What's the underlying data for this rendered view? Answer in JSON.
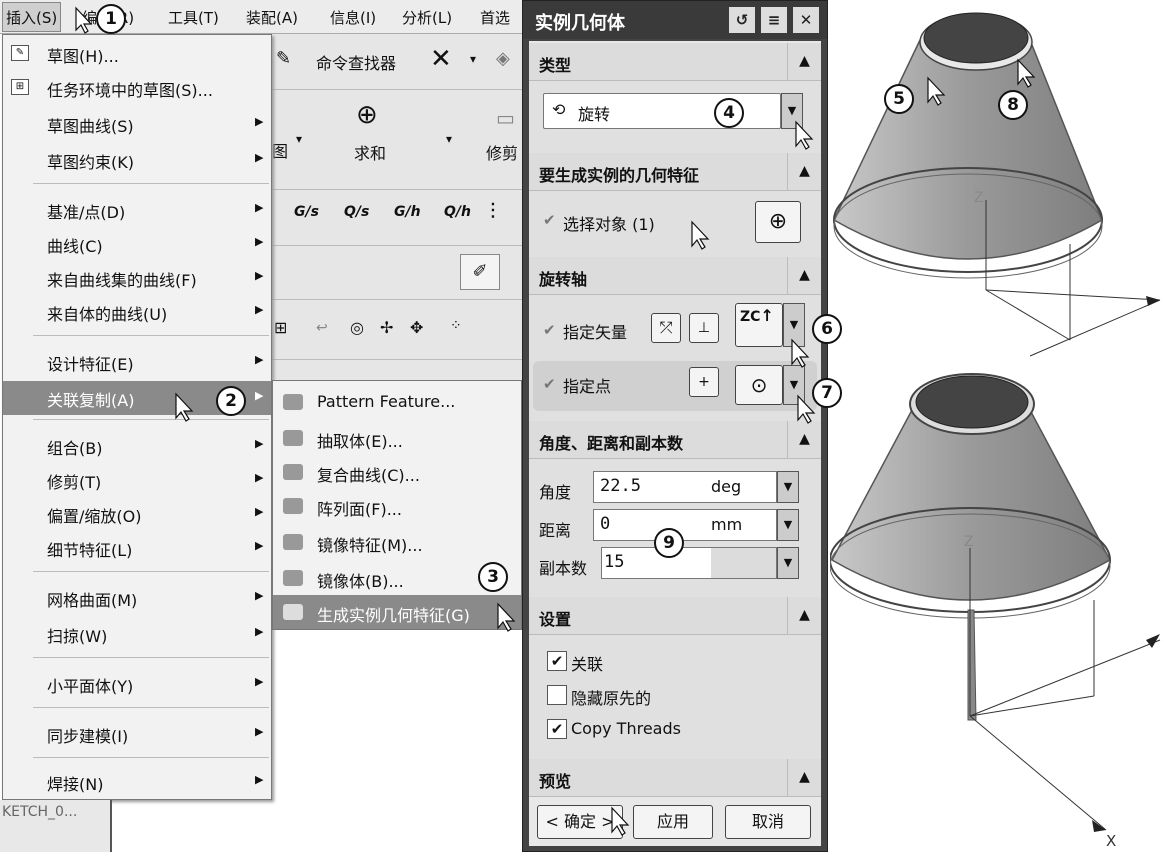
{
  "menubar": {
    "items": [
      "插入(S)",
      "编辑(R)",
      "工具(T)",
      "装配(A)",
      "信息(I)",
      "分析(L)",
      "首选"
    ]
  },
  "toolbar": {
    "command_finder": "命令查找器",
    "sum_label": "求和",
    "trim_label": "修剪",
    "tool_prefix": "图",
    "glyphs": [
      "G/s",
      "Q/s",
      "G/h",
      "Q/h"
    ]
  },
  "menu": {
    "items": [
      {
        "label": "草图(H)...",
        "icon": "sketch-icon",
        "arrow": false
      },
      {
        "label": "任务环境中的草图(S)...",
        "icon": "sketch-task-icon",
        "arrow": false
      },
      {
        "label": "草图曲线(S)",
        "arrow": true
      },
      {
        "label": "草图约束(K)",
        "arrow": true
      },
      {
        "label": "基准/点(D)",
        "arrow": true
      },
      {
        "label": "曲线(C)",
        "arrow": true
      },
      {
        "label": "来自曲线集的曲线(F)",
        "arrow": true
      },
      {
        "label": "来自体的曲线(U)",
        "arrow": true
      },
      {
        "label": "设计特征(E)",
        "arrow": true
      },
      {
        "label": "关联复制(A)",
        "arrow": true,
        "highlight": true
      },
      {
        "label": "组合(B)",
        "arrow": true
      },
      {
        "label": "修剪(T)",
        "arrow": true
      },
      {
        "label": "偏置/缩放(O)",
        "arrow": true
      },
      {
        "label": "细节特征(L)",
        "arrow": true
      },
      {
        "label": "网格曲面(M)",
        "arrow": true
      },
      {
        "label": "扫掠(W)",
        "arrow": true
      },
      {
        "label": "小平面体(Y)",
        "arrow": true
      },
      {
        "label": "同步建模(I)",
        "arrow": true
      },
      {
        "label": "焊接(N)",
        "arrow": true
      }
    ],
    "footer": "KETCH_0..."
  },
  "submenu": {
    "items": [
      {
        "label": "Pattern Feature...",
        "icon": "pattern-feature-icon"
      },
      {
        "label": "抽取体(E)...",
        "icon": "extract-body-icon"
      },
      {
        "label": "复合曲线(C)...",
        "icon": "composite-curve-icon"
      },
      {
        "label": "阵列面(F)...",
        "icon": "pattern-face-icon"
      },
      {
        "label": "镜像特征(M)...",
        "icon": "mirror-feature-icon"
      },
      {
        "label": "镜像体(B)...",
        "icon": "mirror-body-icon"
      },
      {
        "label": "生成实例几何特征(G)",
        "icon": "instance-geometry-icon",
        "highlight": true
      }
    ]
  },
  "dialog": {
    "title": "实例几何体",
    "sections": {
      "type": "类型",
      "geometry": "要生成实例的几何特征",
      "axis": "旋转轴",
      "params": "角度、距离和副本数",
      "settings": "设置",
      "preview": "预览"
    },
    "type_value": "旋转",
    "select_object": "选择对象 (1)",
    "specify_vector": "指定矢量",
    "vector_value": "ZC",
    "specify_point": "指定点",
    "angle_label": "角度",
    "angle_value": "22.5",
    "angle_unit": "deg",
    "distance_label": "距离",
    "distance_value": "0",
    "distance_unit": "mm",
    "copies_label": "副本数",
    "copies_value": "15",
    "settings": {
      "associative": {
        "label": "关联",
        "checked": true
      },
      "hide_original": {
        "label": "隐藏原先的",
        "checked": false
      },
      "copy_threads": {
        "label": "Copy Threads",
        "checked": true
      }
    },
    "ok": "< 确定 >",
    "apply": "应用",
    "cancel": "取消"
  },
  "callouts": [
    "1",
    "2",
    "3",
    "4",
    "5",
    "6",
    "7",
    "8",
    "9"
  ],
  "scene": {
    "axis_z": "Z",
    "axis_x": "X"
  },
  "colors": {
    "title_bg": "#3a3a3a",
    "highlight": "#8a8a8a",
    "cone": "#9a9a9a"
  }
}
